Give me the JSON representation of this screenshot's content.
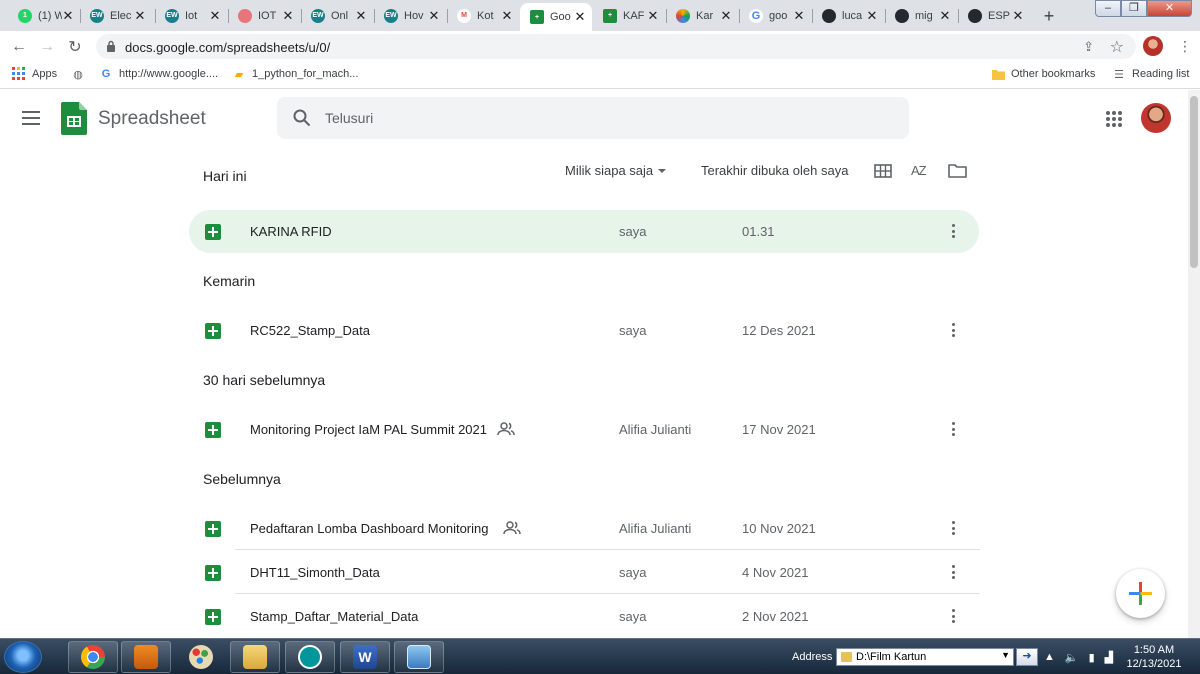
{
  "browser": {
    "tabs": [
      {
        "title": "(1) W",
        "fav_color": "#25d366",
        "fav_text": "1"
      },
      {
        "title": "Elec",
        "fav_color": "#1a7f8a",
        "fav_text": "EW"
      },
      {
        "title": "Iot",
        "fav_color": "#1a7f8a",
        "fav_text": "EW"
      },
      {
        "title": "IOT",
        "fav_color": "#e8747c",
        "fav_text": ""
      },
      {
        "title": "Onl",
        "fav_color": "#1a7f8a",
        "fav_text": "EW"
      },
      {
        "title": "Hov",
        "fav_color": "#1a7f8a",
        "fav_text": "EW"
      },
      {
        "title": "Kot",
        "fav_color": "#ea4335",
        "fav_text": "M"
      },
      {
        "title": "Goo",
        "fav_color": "#1e8e3e",
        "fav_text": "+"
      },
      {
        "title": "KAF",
        "fav_color": "#1e8e3e",
        "fav_text": "+"
      },
      {
        "title": "Kar",
        "fav_color": "#f4b400",
        "fav_text": ""
      },
      {
        "title": "goo",
        "fav_color": "#4285f4",
        "fav_text": "G"
      },
      {
        "title": "luca",
        "fav_color": "#24292f",
        "fav_text": ""
      },
      {
        "title": "mig",
        "fav_color": "#24292f",
        "fav_text": ""
      },
      {
        "title": "ESP",
        "fav_color": "#24292f",
        "fav_text": ""
      }
    ],
    "active_tab_index": 7,
    "url": "docs.google.com/spreadsheets/u/0/",
    "bookmarks": {
      "apps": "Apps",
      "google": "http://www.google....",
      "python": "1_python_for_mach...",
      "other": "Other bookmarks",
      "reading": "Reading list"
    }
  },
  "app": {
    "brand": "Spreadsheet",
    "search_placeholder": "Telusuri"
  },
  "controls": {
    "owner_filter": "Milik siapa saja",
    "sort_label": "Terakhir dibuka oleh saya",
    "sort_icon_text": "AZ"
  },
  "sections": {
    "today": "Hari ini",
    "yesterday": "Kemarin",
    "last30": "30 hari sebelumnya",
    "earlier": "Sebelumnya"
  },
  "files": [
    {
      "name": "KARINA RFID",
      "owner": "saya",
      "date": "01.31",
      "shared": false
    },
    {
      "name": "RC522_Stamp_Data",
      "owner": "saya",
      "date": "12 Des 2021",
      "shared": false
    },
    {
      "name": "Monitoring Project IaM PAL Summit 2021",
      "owner": "Alifia Julianti",
      "date": "17 Nov 2021",
      "shared": true
    },
    {
      "name": "Pedaftaran Lomba Dashboard Monitoring",
      "owner": "Alifia Julianti",
      "date": "10 Nov 2021",
      "shared": true
    },
    {
      "name": "DHT11_Simonth_Data",
      "owner": "saya",
      "date": "4 Nov 2021",
      "shared": false
    },
    {
      "name": "Stamp_Daftar_Material_Data",
      "owner": "saya",
      "date": "2 Nov 2021",
      "shared": false
    }
  ],
  "taskbar": {
    "address_label": "Address",
    "address_value": "D:\\Film Kartun",
    "time": "1:50 AM",
    "date": "12/13/2021"
  },
  "colors": {
    "sheets_green": "#1e8e3e",
    "selected_row": "#e6f4ea"
  }
}
